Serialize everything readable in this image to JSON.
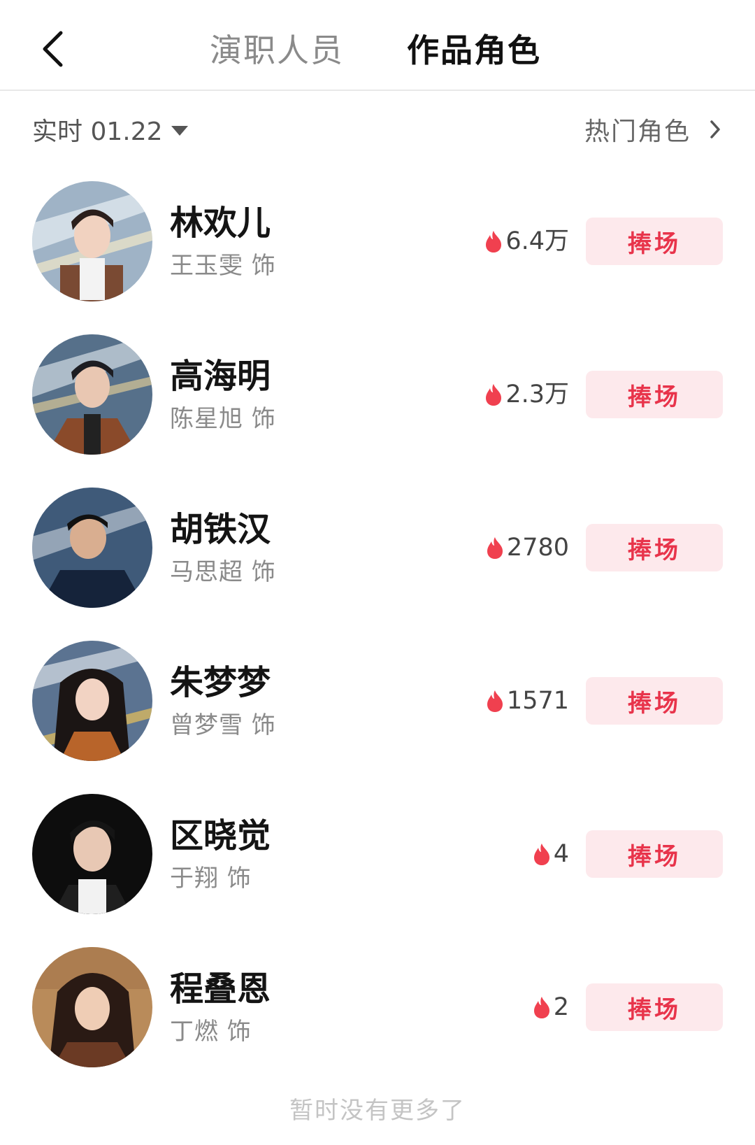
{
  "header": {
    "back_icon": "chevron-left-icon",
    "tabs": [
      {
        "label": "演职人员",
        "active": false
      },
      {
        "label": "作品角色",
        "active": true
      }
    ]
  },
  "filter": {
    "date_label": "实时 01.22",
    "date_icon": "caret-down-icon",
    "hot_roles_label": "热门角色",
    "hot_roles_icon": "chevron-right-icon"
  },
  "colors": {
    "accent": "#e8344b",
    "button_bg": "#fde9ec",
    "flame": "#f0404f"
  },
  "roles": [
    {
      "name": "林欢儿",
      "actor": "王玉雯 饰",
      "heat": "6.4万",
      "button": "捧场"
    },
    {
      "name": "高海明",
      "actor": "陈星旭 饰",
      "heat": "2.3万",
      "button": "捧场"
    },
    {
      "name": "胡铁汉",
      "actor": "马思超 饰",
      "heat": "2780",
      "button": "捧场"
    },
    {
      "name": "朱梦梦",
      "actor": "曾梦雪 饰",
      "heat": "1571",
      "button": "捧场"
    },
    {
      "name": "区晓觉",
      "actor": "于翔 饰",
      "heat": "4",
      "button": "捧场"
    },
    {
      "name": "程叠恩",
      "actor": "丁燃 饰",
      "heat": "2",
      "button": "捧场"
    }
  ],
  "footer": {
    "text": "暂时没有更多了"
  }
}
